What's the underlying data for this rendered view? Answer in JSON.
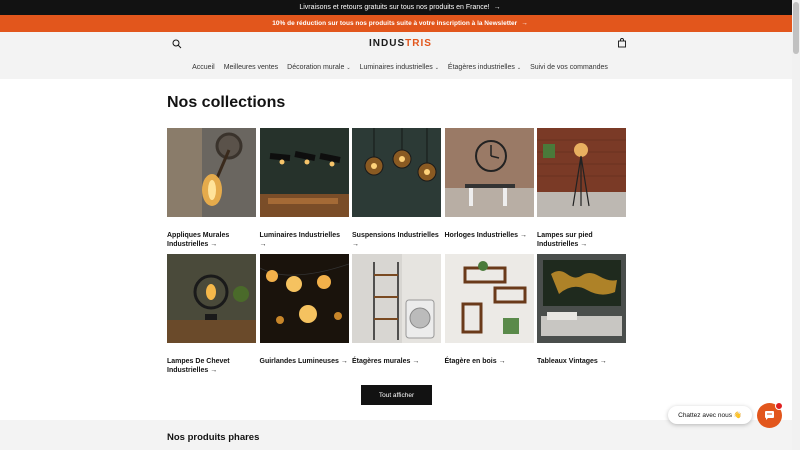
{
  "announcement": {
    "text": "Livraisons et retours gratuits sur tous nos produits en France!",
    "arrow": "→"
  },
  "promo": {
    "text": "10% de réduction sur tous nos produits suite à votre inscription à la Newsletter",
    "arrow": "→"
  },
  "header": {
    "logo_main": "INDUS",
    "logo_accent": "TRIS",
    "search_icon": "search-icon",
    "cart_icon": "cart-icon"
  },
  "nav": {
    "items": [
      {
        "label": "Accueil",
        "dropdown": false
      },
      {
        "label": "Meilleures ventes",
        "dropdown": false
      },
      {
        "label": "Décoration murale",
        "dropdown": true
      },
      {
        "label": "Luminaires industrielles",
        "dropdown": true
      },
      {
        "label": "Étagères industrielles",
        "dropdown": true
      },
      {
        "label": "Suivi de vos commandes",
        "dropdown": false
      }
    ],
    "chevron": "⌄"
  },
  "collections": {
    "title": "Nos collections",
    "items": [
      {
        "label": "Appliques Murales Industrielles",
        "arrow": "→"
      },
      {
        "label": "Luminaires Industrielles",
        "arrow": "→"
      },
      {
        "label": "Suspensions Industrielles",
        "arrow": "→"
      },
      {
        "label": "Horloges Industrielles",
        "arrow": "→"
      },
      {
        "label": "Lampes sur pied Industrielles",
        "arrow": "→"
      },
      {
        "label": "Lampes De Chevet Industrielles",
        "arrow": "→"
      },
      {
        "label": "Guirlandes Lumineuses",
        "arrow": "→"
      },
      {
        "label": "Étagères murales",
        "arrow": "→"
      },
      {
        "label": "Étagère en bois",
        "arrow": "→"
      },
      {
        "label": "Tableaux Vintages",
        "arrow": "→"
      }
    ],
    "view_all": "Tout afficher"
  },
  "featured": {
    "title": "Nos produits phares"
  },
  "chat": {
    "label": "Chattez avec nous 👋"
  },
  "colors": {
    "accent": "#e2561c",
    "dark": "#121212",
    "light_bg": "#f3f3f3"
  }
}
